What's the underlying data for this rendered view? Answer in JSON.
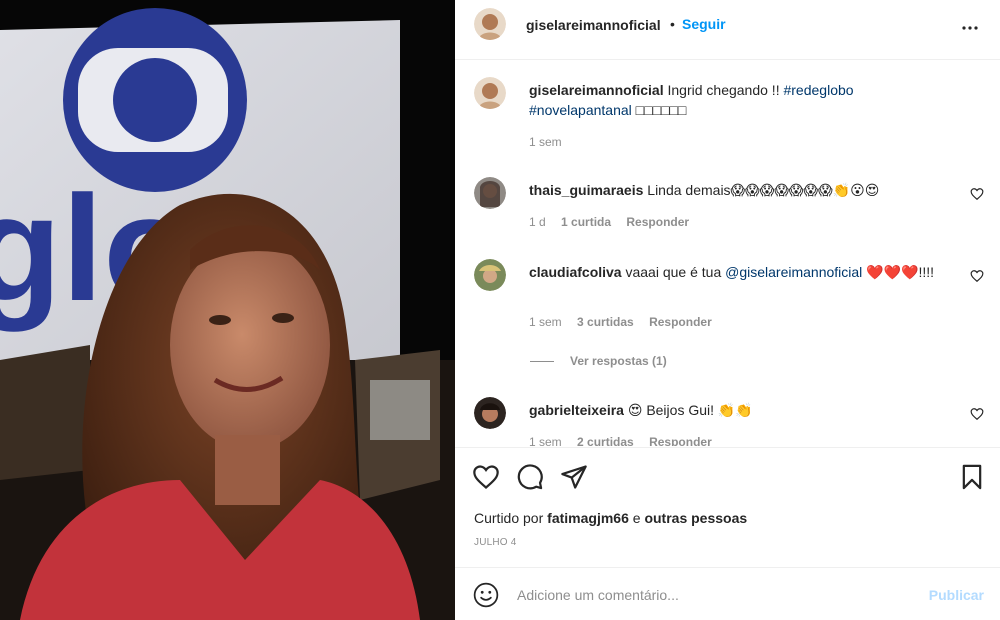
{
  "post": {
    "author": "giselareimannoficial",
    "follow_label": "Seguir",
    "separator": "•",
    "photo_logo_text": "glo"
  },
  "caption": {
    "username": "giselareimannoficial",
    "text": "Ingrid chegando !!",
    "hashtag1": "#redeglobo",
    "hashtag2": "#novelapantanal",
    "tail": "□□□□□□",
    "time": "1 sem"
  },
  "comments": [
    {
      "username": "thais_guimaraeis",
      "text": "Linda demais😱😱😱😱😱😱😱👏😮😍",
      "time": "1 d",
      "likes": "1 curtida",
      "reply": "Responder"
    },
    {
      "username": "claudiafcoliva",
      "text": "vaaai que é tua",
      "mention": "@giselareimannoficial",
      "text_after": "❤️❤️❤️!!!!",
      "time": "1 sem",
      "likes": "3 curtidas",
      "reply": "Responder",
      "view_replies": "Ver respostas (1)"
    },
    {
      "username": "gabrielteixeira",
      "text": "😍 Beijos Gui! 👏👏",
      "time": "1 sem",
      "likes": "2 curtidas",
      "reply": "Responder"
    }
  ],
  "likes_line": {
    "prefix": "Curtido por",
    "user": "fatimagjm66",
    "suffix": "e",
    "others": "outras pessoas"
  },
  "date": "JULHO 4",
  "composer": {
    "placeholder": "Adicione um comentário...",
    "publish_label": "Publicar"
  },
  "icons": {
    "more": "more-options-icon",
    "like": "heart-icon",
    "comment": "comment-icon",
    "share": "share-icon",
    "save": "bookmark-icon",
    "emoji": "emoji-icon"
  },
  "colors": {
    "link_blue": "#0095f6",
    "hashtag": "#00376b",
    "muted": "#8e8e8e",
    "publish_disabled": "#b3dbff"
  }
}
